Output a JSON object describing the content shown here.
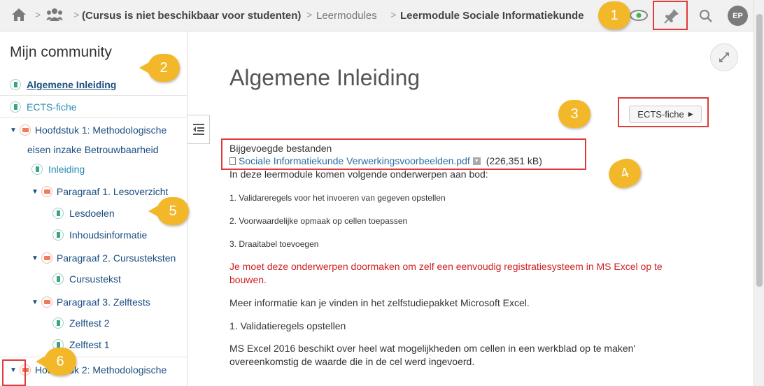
{
  "breadcrumb": {
    "course": "(Cursus is niet beschikbaar voor studenten)",
    "modules": "Leermodules",
    "current": "Leermodule Sociale Informatiekunde"
  },
  "header": {
    "avatar_initials": "EP"
  },
  "sidebar": {
    "title": "Mijn community",
    "items": [
      {
        "label": "Algemene Inleiding"
      },
      {
        "label": "ECTS-fiche"
      },
      {
        "label": "Hoofdstuk 1: Methodologische",
        "label2": "eisen inzake Betrouwbaarheid"
      },
      {
        "label": "Inleiding"
      },
      {
        "label": "Paragraaf 1. Lesoverzicht"
      },
      {
        "label": "Lesdoelen"
      },
      {
        "label": "Inhoudsinformatie"
      },
      {
        "label": "Paragraaf 2. Cursusteksten"
      },
      {
        "label": "Cursustekst"
      },
      {
        "label": "Paragraaf 3. Zelftests"
      },
      {
        "label": "Zelftest 2"
      },
      {
        "label": "Zelftest 1"
      },
      {
        "label": "Hoofdstuk 2: Methodologische"
      }
    ]
  },
  "main": {
    "title": "Algemene Inleiding",
    "ects_button": "ECTS-fiche",
    "attachments_label": "Bijgevoegde bestanden",
    "file_name": "Sociale Informatiekunde Verwerkingsvoorbeelden.pdf",
    "file_size": "(226,351 kB)",
    "intro": "In deze leermodule komen volgende onderwerpen aan bod:",
    "topics": [
      "1. Validareregels voor het invoeren van gegeven opstellen",
      "2. Voorwaardelijke opmaak op cellen toepassen",
      "3. Draaitabel toevoegen"
    ],
    "warning_line1": "Je moet deze onderwerpen doormaken om zelf een eenvoudig registratiesysteem in MS Excel op te",
    "warning_line2": "bouwen.",
    "more_info": "Meer informatie kan je vinden in het zelfstudiepakket Microsoft Excel.",
    "section1": "1. Validatieregels opstellen",
    "para_line1": "MS Excel 2016 beschikt over heel wat mogelijkheden om cellen in een werkblad op te maken'",
    "para_line2": "overeenkomstig de waarde die in de cel werd ingevoerd."
  },
  "callouts": [
    "1",
    "2",
    "3",
    "4",
    "5",
    "6"
  ],
  "colors": {
    "accent": "#f3b72a",
    "highlight": "#e03a3a",
    "link": "#2a8bb3"
  }
}
